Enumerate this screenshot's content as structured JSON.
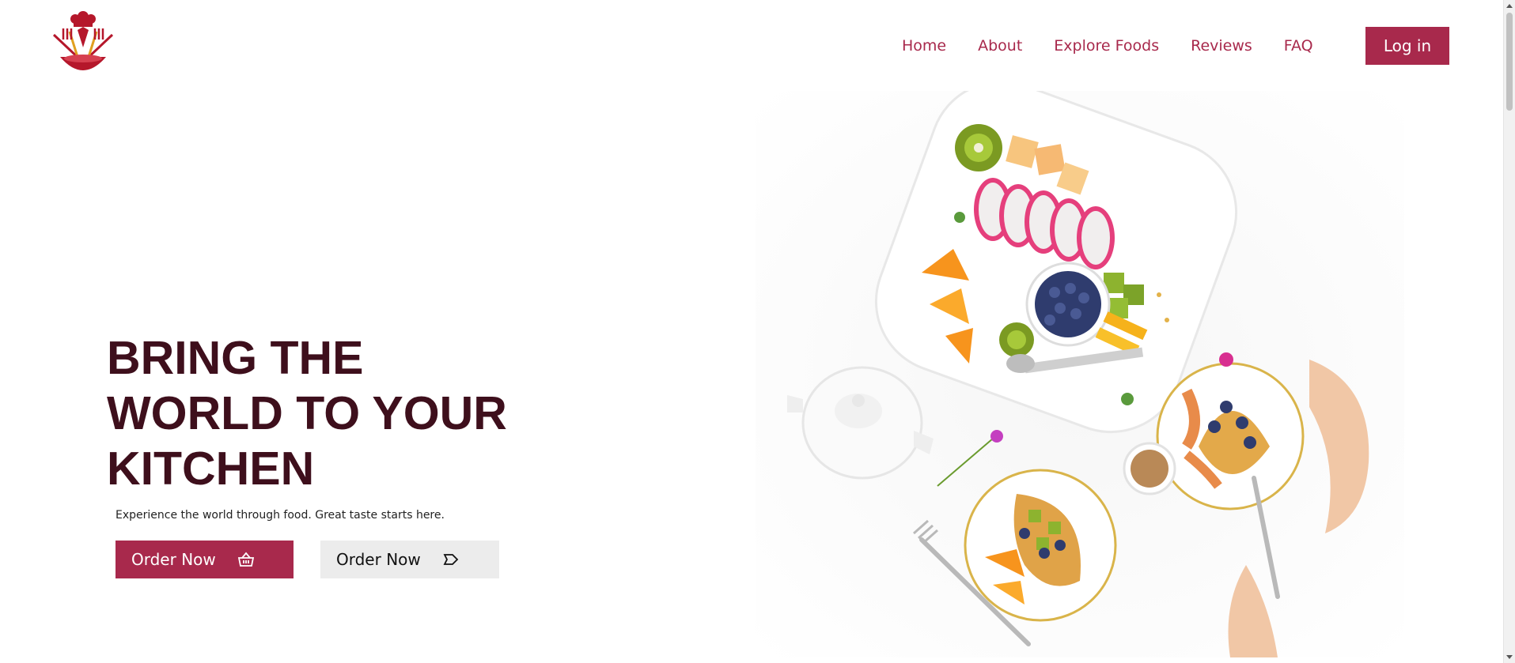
{
  "header": {
    "logo_icon": "chef-bowl-logo-icon",
    "nav": [
      {
        "label": "Home"
      },
      {
        "label": "About"
      },
      {
        "label": "Explore Foods"
      },
      {
        "label": "Reviews"
      },
      {
        "label": "FAQ"
      }
    ],
    "login_label": "Log in"
  },
  "hero": {
    "title_lines": [
      "BRING THE",
      "WORLD TO YOUR",
      "KITCHEN"
    ],
    "subtitle": "Experience the world through food. Great taste starts here.",
    "primary_button": {
      "label": "Order Now",
      "icon": "basket-icon"
    },
    "secondary_button": {
      "label": "Order Now",
      "icon": "tag-icon"
    },
    "image": "food-platter-photo"
  },
  "colors": {
    "accent": "#a8294c",
    "title": "#3e0f1c",
    "secondary_button_bg": "#ececec",
    "background": "#ffffff"
  }
}
